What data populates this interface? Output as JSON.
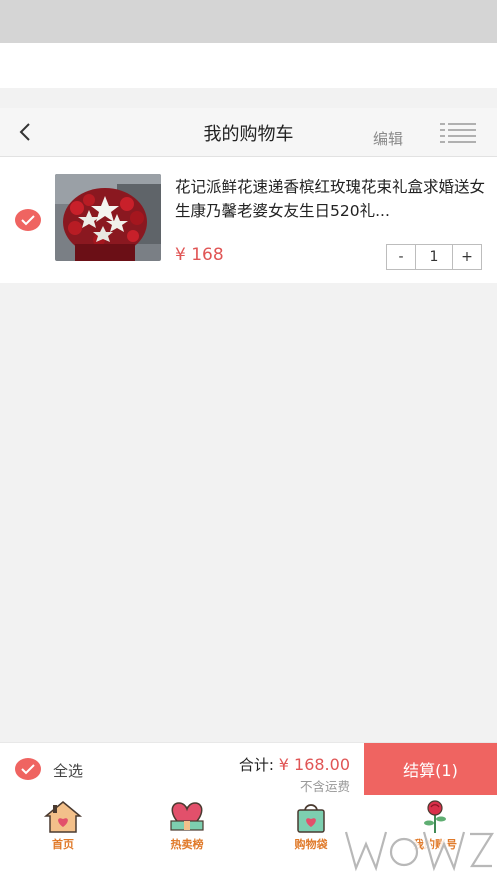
{
  "header": {
    "title": "我的购物车",
    "edit_label": "编辑"
  },
  "cart_items": [
    {
      "title": "花记派鲜花速递香槟红玫瑰花束礼盒求婚送女生康乃馨老婆女友生日520礼...",
      "price": "¥ 168",
      "quantity": "1",
      "decrement_label": "-",
      "increment_label": "+",
      "selected": true
    }
  ],
  "footer": {
    "select_all_label": "全选",
    "total_label": "合计:",
    "total_amount": "¥ 168.00",
    "shipping_note": "不含运费",
    "checkout_label": "结算(1)"
  },
  "tabs": [
    {
      "label": "首页",
      "icon": "home-icon"
    },
    {
      "label": "热卖榜",
      "icon": "heart-gift-icon"
    },
    {
      "label": "购物袋",
      "icon": "shopping-bag-icon"
    },
    {
      "label": "我的账号",
      "icon": "rose-icon"
    }
  ],
  "colors": {
    "accent": "#ef6461",
    "price": "#e05555",
    "tab_label": "#e07a2a"
  }
}
